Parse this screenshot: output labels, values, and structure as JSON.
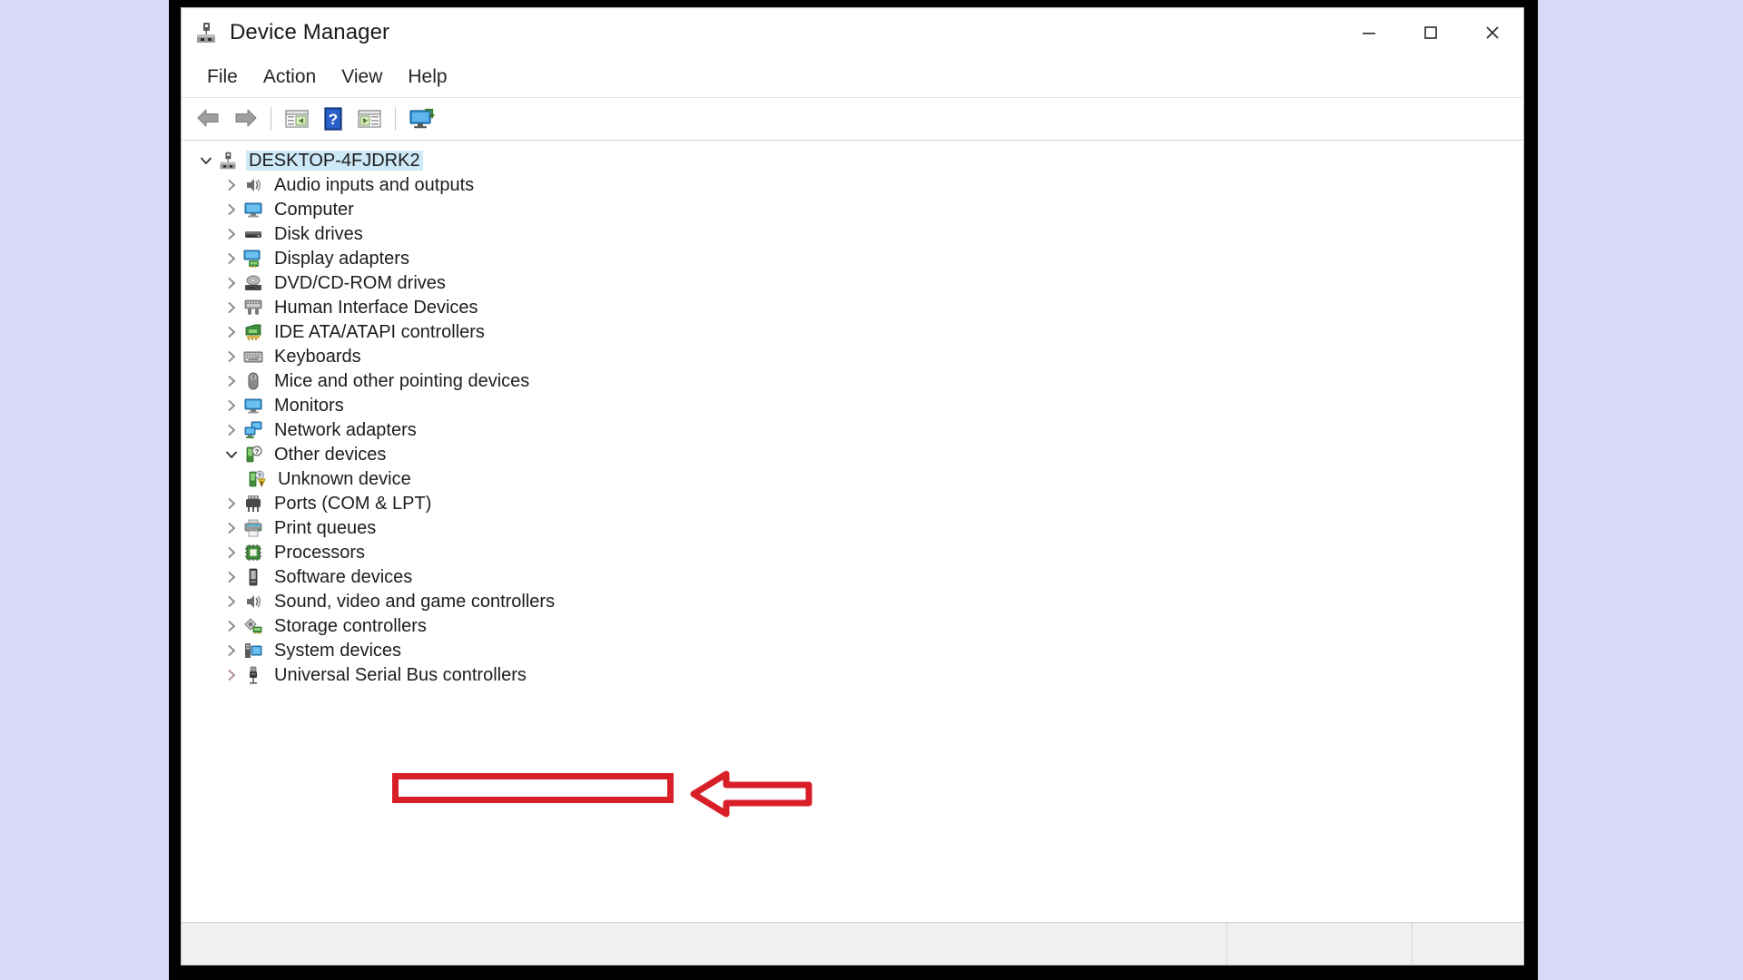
{
  "window": {
    "title": "Device Manager",
    "title_icon": "device-manager-icon",
    "caption": {
      "minimize": "minimize-icon",
      "maximize": "maximize-icon",
      "close": "close-icon"
    }
  },
  "menubar": {
    "items": [
      {
        "label": "File",
        "name": "menu-file"
      },
      {
        "label": "Action",
        "name": "menu-action"
      },
      {
        "label": "View",
        "name": "menu-view"
      },
      {
        "label": "Help",
        "name": "menu-help"
      }
    ]
  },
  "toolbar": {
    "buttons": [
      {
        "name": "back-icon",
        "tip": "Back"
      },
      {
        "name": "forward-icon",
        "tip": "Forward"
      },
      {
        "name": "properties-icon",
        "tip": "Properties"
      },
      {
        "name": "help-icon",
        "tip": "Help"
      },
      {
        "name": "show-hide-console-tree-icon",
        "tip": "Show/Hide console tree"
      },
      {
        "name": "scan-for-hardware-changes-icon",
        "tip": "Scan for hardware changes"
      }
    ]
  },
  "tree": {
    "root": {
      "label": "DESKTOP-4FJDRK2",
      "icon": "computer-root-icon",
      "expanded": true,
      "selected": true
    },
    "items": [
      {
        "label": "Audio inputs and outputs",
        "icon": "speaker-icon",
        "expanded": false,
        "level": 1
      },
      {
        "label": "Computer",
        "icon": "monitor-icon",
        "expanded": false,
        "level": 1
      },
      {
        "label": "Disk drives",
        "icon": "disk-drive-icon",
        "expanded": false,
        "level": 1
      },
      {
        "label": "Display adapters",
        "icon": "display-adapter-icon",
        "expanded": false,
        "level": 1
      },
      {
        "label": "DVD/CD-ROM drives",
        "icon": "optical-drive-icon",
        "expanded": false,
        "level": 1
      },
      {
        "label": "Human Interface Devices",
        "icon": "hid-icon",
        "expanded": false,
        "level": 1
      },
      {
        "label": "IDE ATA/ATAPI controllers",
        "icon": "ide-controller-icon",
        "expanded": false,
        "level": 1
      },
      {
        "label": "Keyboards",
        "icon": "keyboard-icon",
        "expanded": false,
        "level": 1
      },
      {
        "label": "Mice and other pointing devices",
        "icon": "mouse-icon",
        "expanded": false,
        "level": 1
      },
      {
        "label": "Monitors",
        "icon": "monitor-icon",
        "expanded": false,
        "level": 1
      },
      {
        "label": "Network adapters",
        "icon": "network-adapter-icon",
        "expanded": false,
        "level": 1
      },
      {
        "label": "Other devices",
        "icon": "other-device-icon",
        "expanded": true,
        "level": 1
      },
      {
        "label": "Unknown device",
        "icon": "unknown-device-warning-icon",
        "expanded": null,
        "level": 2
      },
      {
        "label": "Ports (COM & LPT)",
        "icon": "port-icon",
        "expanded": false,
        "level": 1
      },
      {
        "label": "Print queues",
        "icon": "printer-icon",
        "expanded": false,
        "level": 1
      },
      {
        "label": "Processors",
        "icon": "processor-icon",
        "expanded": false,
        "level": 1
      },
      {
        "label": "Software devices",
        "icon": "software-device-icon",
        "expanded": false,
        "level": 1
      },
      {
        "label": "Sound, video and game controllers",
        "icon": "speaker-icon",
        "expanded": false,
        "level": 1
      },
      {
        "label": "Storage controllers",
        "icon": "storage-controller-icon",
        "expanded": false,
        "level": 1
      },
      {
        "label": "System devices",
        "icon": "system-device-icon",
        "expanded": false,
        "level": 1
      },
      {
        "label": "Universal Serial Bus controllers",
        "icon": "usb-controller-icon",
        "expanded": false,
        "level": 1,
        "highlighted": true
      }
    ]
  },
  "annotations": {
    "highlight_color": "#d81f27",
    "box_target": "Universal Serial Bus controllers",
    "arrow": "left-pointing-arrow",
    "arrow_direction": "left"
  },
  "statusbar": {
    "panes": [
      "",
      "",
      ""
    ]
  },
  "colors": {
    "selection": "#cde8f6",
    "annotation_red": "#d81f27",
    "desktop_background": "#d9d9f7",
    "window_background": "#ffffff"
  }
}
